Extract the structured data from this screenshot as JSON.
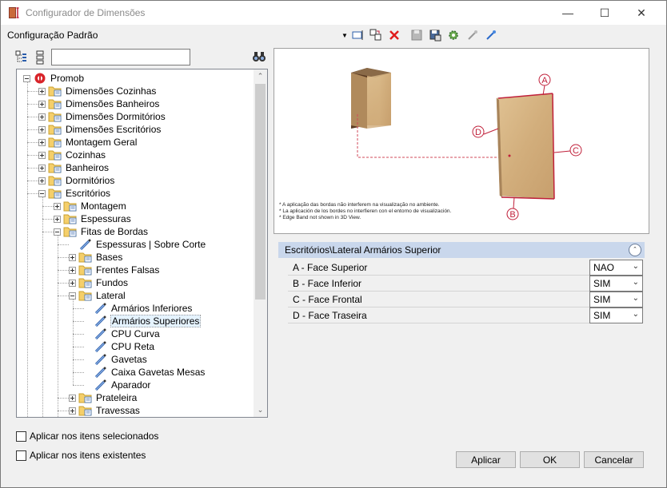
{
  "window": {
    "title": "Configurador de Dimensões",
    "minimize_icon": "minimize-icon",
    "maximize_icon": "maximize-icon",
    "close_icon": "close-icon"
  },
  "toolbar": {
    "config_label": "Configuração Padrão",
    "buttons": [
      "dropdown-arrow-icon",
      "new-config-icon",
      "copy-config-icon",
      "delete-icon",
      "save-icon",
      "save-as-icon",
      "settings-icon",
      "import-icon",
      "export-icon"
    ]
  },
  "tree_tools": {
    "search_value": "",
    "search_icon": "binoculars-icon"
  },
  "tree": {
    "items": [
      {
        "label": "Promob",
        "level": 0,
        "expander": "minus",
        "icon": "promob-logo-icon"
      },
      {
        "label": "Dimensões Cozinhas",
        "level": 1,
        "expander": "plus",
        "icon": "folder-icon"
      },
      {
        "label": "Dimensões Banheiros",
        "level": 1,
        "expander": "plus",
        "icon": "folder-icon"
      },
      {
        "label": "Dimensões Dormitórios",
        "level": 1,
        "expander": "plus",
        "icon": "folder-icon"
      },
      {
        "label": "Dimensões Escritórios",
        "level": 1,
        "expander": "plus",
        "icon": "folder-icon"
      },
      {
        "label": "Montagem Geral",
        "level": 1,
        "expander": "plus",
        "icon": "folder-icon"
      },
      {
        "label": "Cozinhas",
        "level": 1,
        "expander": "plus",
        "icon": "folder-icon"
      },
      {
        "label": "Banheiros",
        "level": 1,
        "expander": "plus",
        "icon": "folder-icon"
      },
      {
        "label": "Dormitórios",
        "level": 1,
        "expander": "plus",
        "icon": "folder-icon"
      },
      {
        "label": "Escritórios",
        "level": 1,
        "expander": "minus",
        "icon": "folder-icon"
      },
      {
        "label": "Montagem",
        "level": 2,
        "expander": "plus",
        "icon": "folder-icon"
      },
      {
        "label": "Espessuras",
        "level": 2,
        "expander": "plus",
        "icon": "folder-icon"
      },
      {
        "label": "Fitas de Bordas",
        "level": 2,
        "expander": "minus",
        "icon": "folder-icon"
      },
      {
        "label": "Espessuras | Sobre Corte",
        "level": 3,
        "expander": "none",
        "icon": "edge-band-icon"
      },
      {
        "label": "Bases",
        "level": 3,
        "expander": "plus",
        "icon": "folder-icon"
      },
      {
        "label": "Frentes Falsas",
        "level": 3,
        "expander": "plus",
        "icon": "folder-icon"
      },
      {
        "label": "Fundos",
        "level": 3,
        "expander": "plus",
        "icon": "folder-icon"
      },
      {
        "label": "Lateral",
        "level": 3,
        "expander": "minus",
        "icon": "folder-icon"
      },
      {
        "label": "Armários Inferiores",
        "level": 4,
        "expander": "none",
        "icon": "edge-band-icon"
      },
      {
        "label": "Armários Superiores",
        "level": 4,
        "expander": "none",
        "icon": "edge-band-icon",
        "selected": true
      },
      {
        "label": "CPU Curva",
        "level": 4,
        "expander": "none",
        "icon": "edge-band-icon"
      },
      {
        "label": "CPU Reta",
        "level": 4,
        "expander": "none",
        "icon": "edge-band-icon"
      },
      {
        "label": "Gavetas",
        "level": 4,
        "expander": "none",
        "icon": "edge-band-icon"
      },
      {
        "label": "Caixa Gavetas Mesas",
        "level": 4,
        "expander": "none",
        "icon": "edge-band-icon"
      },
      {
        "label": "Aparador",
        "level": 4,
        "expander": "none",
        "icon": "edge-band-icon"
      },
      {
        "label": "Prateleira",
        "level": 3,
        "expander": "plus",
        "icon": "folder-icon"
      },
      {
        "label": "Travessas",
        "level": 3,
        "expander": "plus",
        "icon": "folder-icon"
      }
    ]
  },
  "preview": {
    "markers": [
      "A",
      "B",
      "C",
      "D"
    ],
    "notes": [
      "* A aplicação das bordas não interferem na visualização no ambiente.",
      "* La aplicación de los bordes no interfieren con el entorno de visualización.",
      "* Edge Band not shown in 3D View."
    ]
  },
  "properties": {
    "header": "Escritórios\\Lateral Armários Superior",
    "rows": [
      {
        "name": "A - Face Superior",
        "value": "NAO"
      },
      {
        "name": "B - Face Inferior",
        "value": "SIM"
      },
      {
        "name": "C - Face Frontal",
        "value": "SIM"
      },
      {
        "name": "D - Face Traseira",
        "value": "SIM"
      }
    ]
  },
  "options": {
    "apply_selected": "Aplicar nos itens selecionados",
    "apply_existing": "Aplicar nos itens existentes"
  },
  "buttons": {
    "apply": "Aplicar",
    "ok": "OK",
    "cancel": "Cancelar"
  },
  "colors": {
    "accent_header": "#c9d7ec",
    "edge_red": "#c0203a",
    "wood": "#d9b88a"
  }
}
